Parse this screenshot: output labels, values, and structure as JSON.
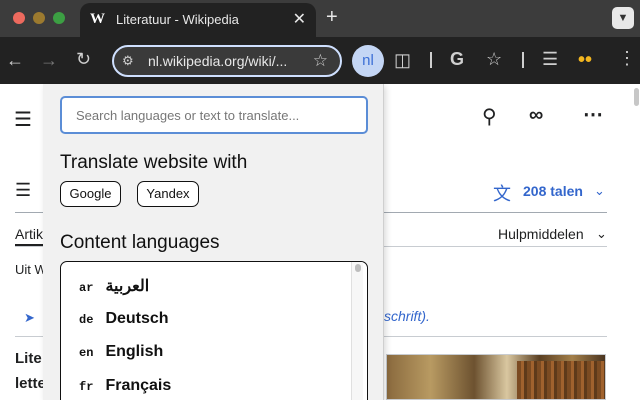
{
  "browser": {
    "tab": {
      "favicon": "W",
      "title": "Literatuur - Wikipedia",
      "close": "✕"
    },
    "new_tab": "+",
    "tabs_menu_icon": "chevron-down-icon",
    "url": "nl.wikipedia.org/wiki/...",
    "extension_label": "nl"
  },
  "page": {
    "language_count": "208 talen",
    "article_tab": "Artik",
    "tools_label": "Hulpmiddelen",
    "from_wiki": "Uit W",
    "hatnote_text": "schrift).",
    "body_line1": "Lite",
    "body_line2": "lette"
  },
  "popup": {
    "search_placeholder": "Search languages or text to translate...",
    "translate_heading": "Translate website with",
    "translate_buttons": [
      "Google",
      "Yandex"
    ],
    "content_heading": "Content languages",
    "languages": [
      {
        "code": "ar",
        "name": "العربية"
      },
      {
        "code": "de",
        "name": "Deutsch"
      },
      {
        "code": "en",
        "name": "English"
      },
      {
        "code": "fr",
        "name": "Français"
      }
    ]
  },
  "colors": {
    "link": "#3366cc",
    "focus_border": "#5b8dd6",
    "extension_badge": "#c4d6f5"
  }
}
